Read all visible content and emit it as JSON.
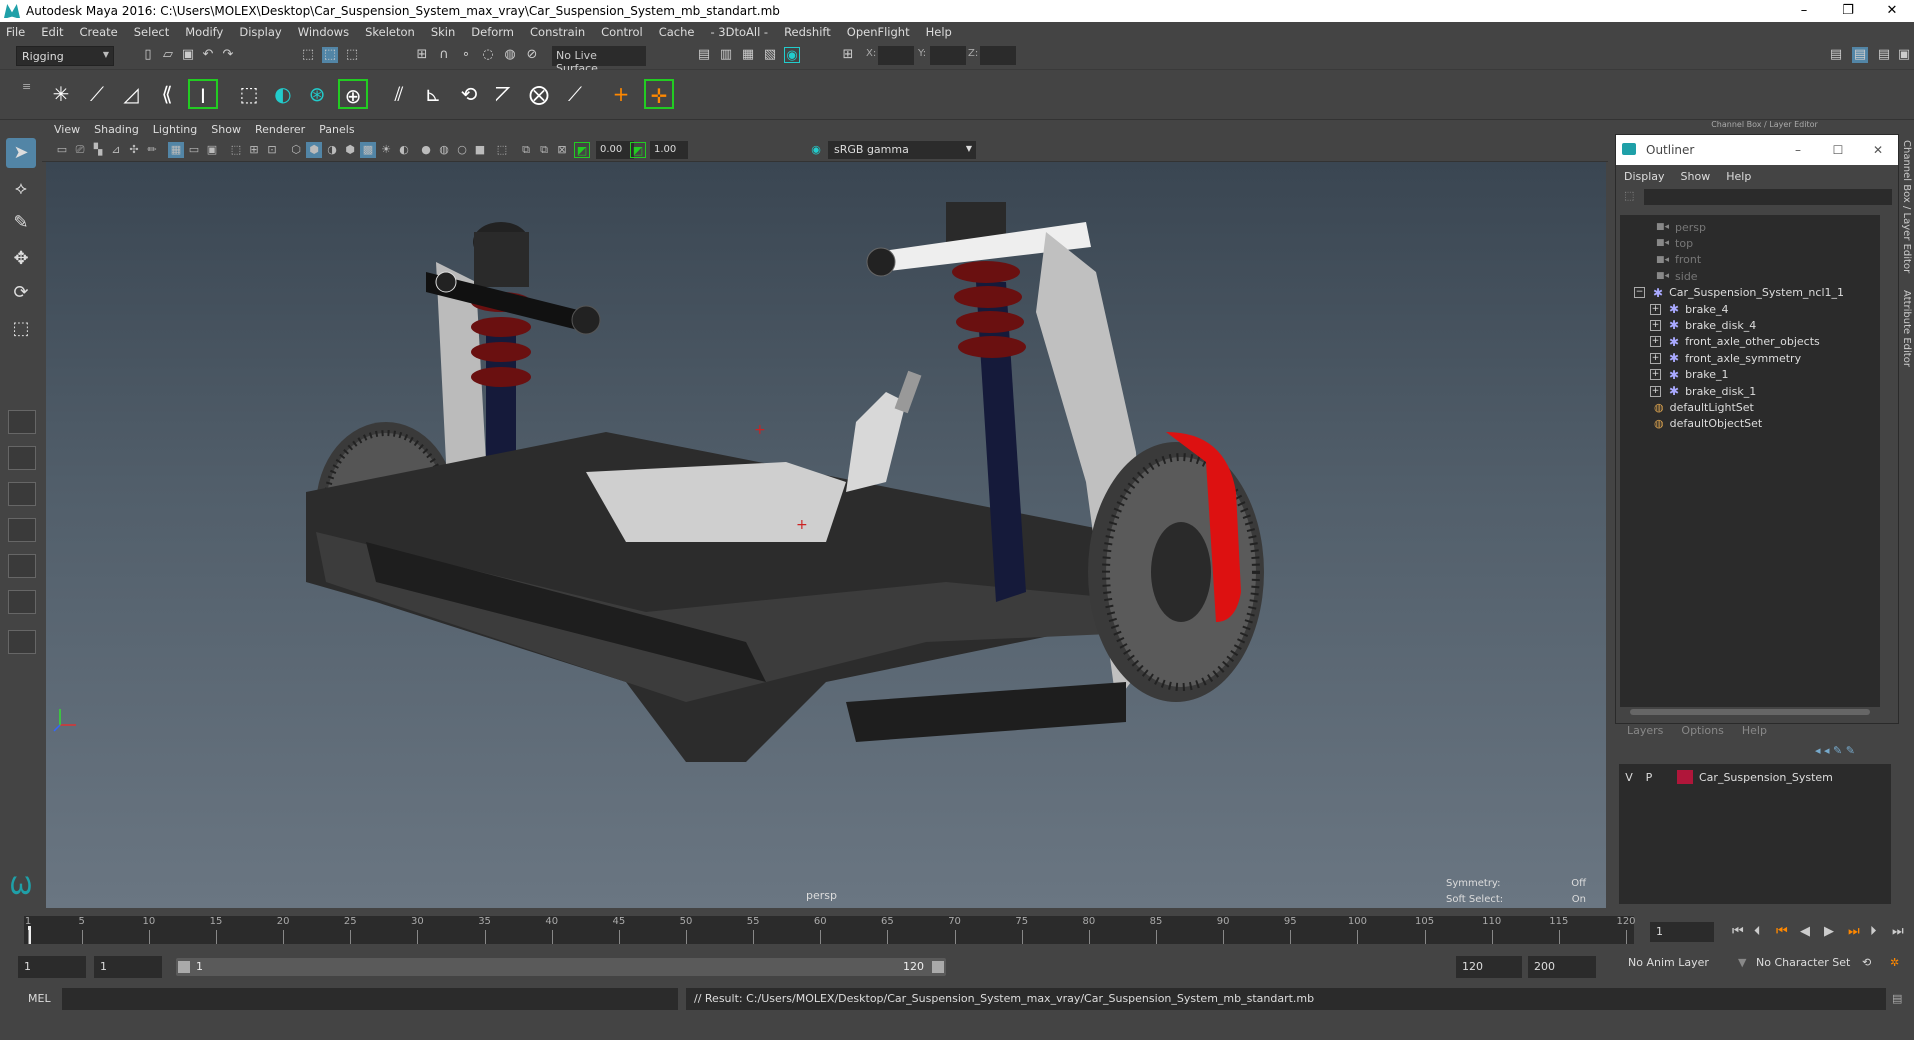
{
  "window": {
    "title": "Autodesk Maya 2016: C:\\Users\\MOLEX\\Desktop\\Car_Suspension_System_max_vray\\Car_Suspension_System_mb_standart.mb",
    "min": "–",
    "max": "❐",
    "close": "✕"
  },
  "menubar": [
    "File",
    "Edit",
    "Create",
    "Select",
    "Modify",
    "Display",
    "Windows",
    "Skeleton",
    "Skin",
    "Deform",
    "Constrain",
    "Control",
    "Cache",
    "- 3DtoAll -",
    "Redshift",
    "OpenFlight",
    "Help"
  ],
  "status": {
    "mode": "Rigging",
    "live_surface": "No Live Surface",
    "x": "X:",
    "y": "Y:",
    "z": "Z:"
  },
  "panel_menu": [
    "View",
    "Shading",
    "Lighting",
    "Show",
    "Renderer",
    "Panels"
  ],
  "panel_toolbar": {
    "exposure": "0.00",
    "gamma_value": "1.00",
    "color_space": "sRGB gamma"
  },
  "viewport": {
    "camera": "persp",
    "symmetry_label": "Symmetry:",
    "symmetry_value": "Off",
    "soft_select_label": "Soft Select:",
    "soft_select_value": "On"
  },
  "outliner": {
    "header": "Channel Box / Layer Editor",
    "title": "Outliner",
    "menu": [
      "Display",
      "Show",
      "Help"
    ],
    "cameras": [
      "persp",
      "top",
      "front",
      "side"
    ],
    "root": "Car_Suspension_System_ncl1_1",
    "children": [
      "brake_4",
      "brake_disk_4",
      "front_axle_other_objects",
      "front_axle_symmetry",
      "brake_1",
      "brake_disk_1"
    ],
    "sets": [
      "defaultLightSet",
      "defaultObjectSet"
    ]
  },
  "layers": {
    "menu": [
      "Layers",
      "Options",
      "Help"
    ],
    "v": "V",
    "p": "P",
    "name": "Car_Suspension_System",
    "color": "#b0163a"
  },
  "right_tabs": [
    "Channel Box / Layer Editor",
    "Attribute Editor"
  ],
  "timeline": {
    "ticks": [
      1,
      5,
      10,
      15,
      20,
      25,
      30,
      35,
      40,
      45,
      50,
      55,
      60,
      65,
      70,
      75,
      80,
      85,
      90,
      95,
      100,
      105,
      110,
      115,
      120
    ],
    "current_frame": "1"
  },
  "range": {
    "start": "1",
    "start2": "1",
    "slider_start": "1",
    "slider_end": "120",
    "end": "120",
    "end2": "200",
    "anim_layer": "No Anim Layer",
    "char_set": "No Character Set"
  },
  "command": {
    "lang": "MEL",
    "result": "// Result: C:/Users/MOLEX/Desktop/Car_Suspension_System_max_vray/Car_Suspension_System_mb_standart.mb"
  }
}
